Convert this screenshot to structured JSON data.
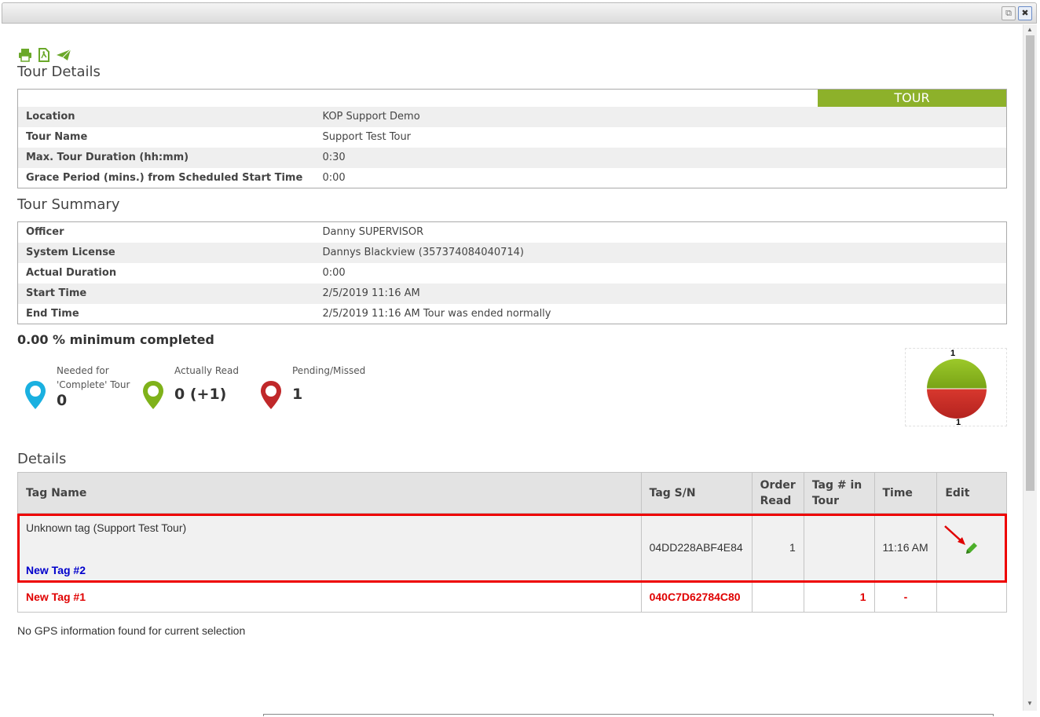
{
  "window": {
    "restore_icon": "restore-icon",
    "close_icon": "close-icon"
  },
  "toolbar": {
    "icons": [
      "print-icon",
      "pdf-icon",
      "send-icon"
    ],
    "icon_color": "#6aa82a"
  },
  "tour_details": {
    "title": "Tour Details",
    "badge": "TOUR",
    "badge_color": "#8db12a",
    "rows": [
      {
        "label": "Location",
        "value": "KOP Support Demo"
      },
      {
        "label": "Tour Name",
        "value": "Support Test Tour"
      },
      {
        "label": "Max. Tour Duration (hh:mm)",
        "value": "0:30"
      },
      {
        "label": "Grace Period (mins.) from Scheduled Start Time",
        "value": "0:00"
      }
    ]
  },
  "tour_summary": {
    "title": "Tour Summary",
    "rows": [
      {
        "label": "Officer",
        "value": "Danny SUPERVISOR"
      },
      {
        "label": "System License",
        "value": "Dannys Blackview (357374084040714)"
      },
      {
        "label": "Actual Duration",
        "value": "0:00"
      },
      {
        "label": "Start Time",
        "value": "2/5/2019 11:16 AM"
      },
      {
        "label": "End Time",
        "value": "2/5/2019 11:16 AM Tour was ended normally"
      }
    ]
  },
  "completion": {
    "percent_text": "0.00 % minimum completed",
    "stats": [
      {
        "label_line1": "Needed for",
        "label_line2": "'Complete' Tour",
        "value": "0",
        "color": "#1ab0e0"
      },
      {
        "label_line1": "Actually Read",
        "label_line2": "",
        "value": "0 (+1)",
        "color": "#7fb21a"
      },
      {
        "label_line1": "Pending/Missed",
        "label_line2": "",
        "value": "1",
        "color": "#c0282a"
      }
    ],
    "pie": {
      "top_label": "1",
      "bottom_label": "1",
      "top_color": "#8ab720",
      "bottom_color": "#c8302a"
    }
  },
  "details": {
    "title": "Details",
    "columns": [
      "Tag Name",
      "Tag S/N",
      "Order Read",
      "Tag # in Tour",
      "Time",
      "Edit"
    ],
    "rows": [
      {
        "tag_name": "Unknown tag (Support Test Tour)",
        "tag_link": "New Tag #2",
        "serial": "04DD228ABF4E84",
        "order_read": "1",
        "tag_in_tour": "",
        "time": "11:16 AM",
        "edit_icon": "pencil-icon"
      },
      {
        "tag_name": "New Tag #1",
        "serial": "040C7D62784C80",
        "order_read": "",
        "tag_in_tour": "1",
        "time": "-",
        "edit_icon": ""
      }
    ],
    "no_gps": "No GPS information found for current selection"
  }
}
